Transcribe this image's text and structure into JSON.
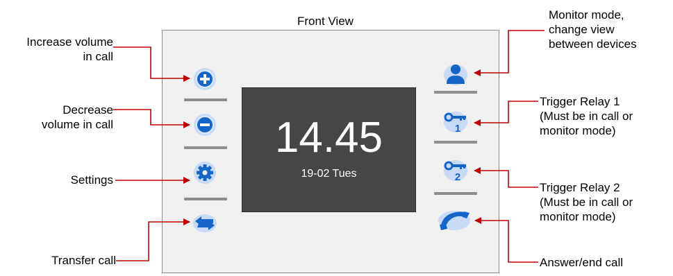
{
  "title": "Front View",
  "screen": {
    "time": "14.45",
    "date": "19-02  Tues"
  },
  "labels": {
    "increase_volume": [
      "Increase volume",
      "in call"
    ],
    "decrease_volume": [
      "Decrease",
      "volume in call"
    ],
    "settings": "Settings",
    "transfer_call": "Transfer call",
    "monitor_mode": [
      "Monitor mode,",
      "change view",
      "between devices"
    ],
    "trigger_relay_1": [
      "Trigger Relay 1",
      "(Must be in call or",
      "monitor mode)"
    ],
    "trigger_relay_2": [
      "Trigger Relay 2",
      "(Must be in call or",
      "monitor mode)"
    ],
    "answer_end_call": "Answer/end call"
  },
  "icons": {
    "left": [
      "plus-circle-icon",
      "minus-circle-icon",
      "gear-icon",
      "transfer-arrows-icon"
    ],
    "right": [
      "user-icon",
      "key-1-icon",
      "key-2-icon",
      "phone-handset-icon"
    ]
  },
  "colors": {
    "icon_blue": "#1565c8",
    "icon_glow": "#7fb3ff",
    "arrow_red": "#c00000",
    "screen_bg": "#464646",
    "device_bg": "#f0f0f0"
  }
}
